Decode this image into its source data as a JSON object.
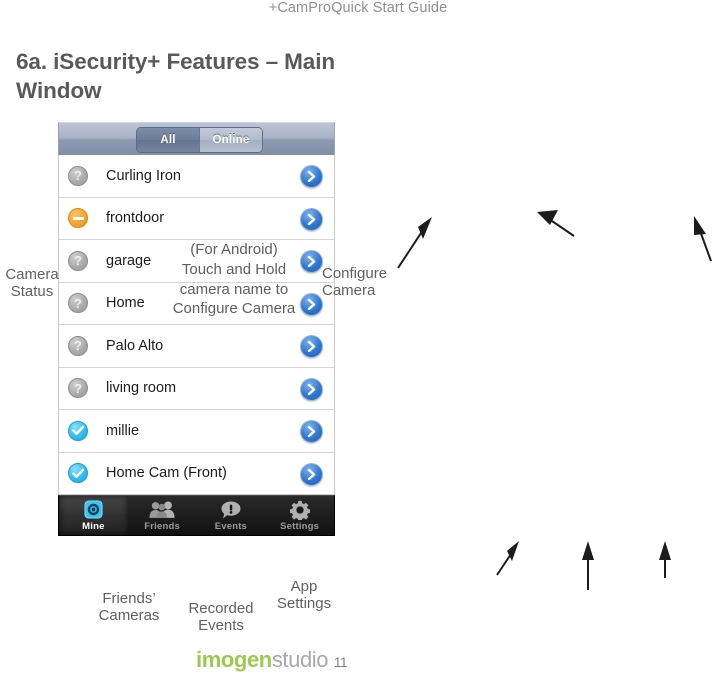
{
  "document": {
    "header": "+CamProQuick Start Guide",
    "title": "6a. iSecurity+ Features – Main Window",
    "page_number": "11"
  },
  "footer": {
    "brand_bold": "imogen",
    "brand_light": "studio",
    "page": "11",
    "brand_color": "#9cc94f",
    "brand_light_color": "#a8a8a8"
  },
  "phone": {
    "segmented_control": {
      "options": [
        "All",
        "Online"
      ],
      "selected": "All"
    },
    "camera_list": [
      {
        "name": "Curling Iron",
        "status": "unknown",
        "status_icon": "question-circle-icon",
        "disclosure_icon": "chevron-right-circle-icon"
      },
      {
        "name": "frontdoor",
        "status": "offline",
        "status_icon": "minus-circle-icon",
        "disclosure_icon": "chevron-right-circle-icon"
      },
      {
        "name": "garage",
        "status": "unknown",
        "status_icon": "question-circle-icon",
        "disclosure_icon": "chevron-right-circle-icon"
      },
      {
        "name": "Home",
        "status": "unknown",
        "status_icon": "question-circle-icon",
        "disclosure_icon": "chevron-right-circle-icon"
      },
      {
        "name": "Palo Alto",
        "status": "unknown",
        "status_icon": "question-circle-icon",
        "disclosure_icon": "chevron-right-circle-icon"
      },
      {
        "name": "living room",
        "status": "unknown",
        "status_icon": "question-circle-icon",
        "disclosure_icon": "chevron-right-circle-icon"
      },
      {
        "name": "millie",
        "status": "online",
        "status_icon": "check-circle-icon",
        "disclosure_icon": "chevron-right-circle-icon"
      },
      {
        "name": "Home Cam (Front)",
        "status": "online",
        "status_icon": "check-circle-icon",
        "disclosure_icon": "chevron-right-circle-icon"
      }
    ],
    "tabbar": [
      {
        "label": "Mine",
        "icon": "camera-icon",
        "active": true
      },
      {
        "label": "Friends",
        "icon": "people-icon",
        "active": false
      },
      {
        "label": "Events",
        "icon": "alert-bubble-icon",
        "active": false
      },
      {
        "label": "Settings",
        "icon": "gear-icon",
        "active": false
      }
    ]
  },
  "annotations": {
    "camera_status": "Camera\nStatus",
    "configure_camera": "Configure\nCamera",
    "android_note": "(For Android) Touch and Hold camera name to Configure Camera",
    "friends_cameras": "Friends’\nCameras",
    "recorded_events": "Recorded\nEvents",
    "app_settings": "App\nSettings"
  },
  "colors": {
    "status_unknown": "#a9a9a9",
    "status_offline": "#f2a32e",
    "status_online": "#31bdee",
    "disclosure_blue": "#2f77cf",
    "heading": "#595959",
    "annotation": "#606060"
  }
}
